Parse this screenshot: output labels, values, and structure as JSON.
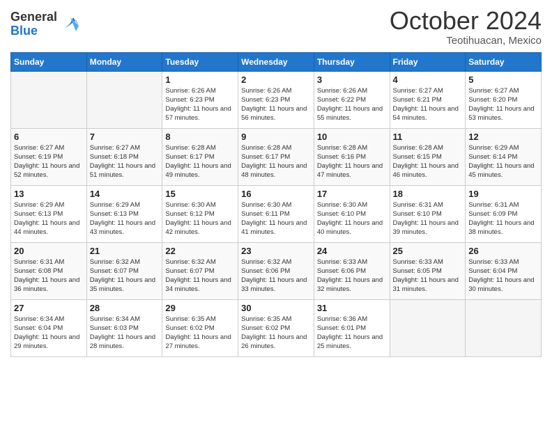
{
  "header": {
    "logo": {
      "general": "General",
      "blue": "Blue"
    },
    "month": "October 2024",
    "location": "Teotihuacan, Mexico"
  },
  "weekdays": [
    "Sunday",
    "Monday",
    "Tuesday",
    "Wednesday",
    "Thursday",
    "Friday",
    "Saturday"
  ],
  "weeks": [
    [
      {
        "day": "",
        "sunrise": "",
        "sunset": "",
        "daylight": "",
        "empty": true
      },
      {
        "day": "",
        "sunrise": "",
        "sunset": "",
        "daylight": "",
        "empty": true
      },
      {
        "day": "1",
        "sunrise": "Sunrise: 6:26 AM",
        "sunset": "Sunset: 6:23 PM",
        "daylight": "Daylight: 11 hours and 57 minutes.",
        "empty": false
      },
      {
        "day": "2",
        "sunrise": "Sunrise: 6:26 AM",
        "sunset": "Sunset: 6:23 PM",
        "daylight": "Daylight: 11 hours and 56 minutes.",
        "empty": false
      },
      {
        "day": "3",
        "sunrise": "Sunrise: 6:26 AM",
        "sunset": "Sunset: 6:22 PM",
        "daylight": "Daylight: 11 hours and 55 minutes.",
        "empty": false
      },
      {
        "day": "4",
        "sunrise": "Sunrise: 6:27 AM",
        "sunset": "Sunset: 6:21 PM",
        "daylight": "Daylight: 11 hours and 54 minutes.",
        "empty": false
      },
      {
        "day": "5",
        "sunrise": "Sunrise: 6:27 AM",
        "sunset": "Sunset: 6:20 PM",
        "daylight": "Daylight: 11 hours and 53 minutes.",
        "empty": false
      }
    ],
    [
      {
        "day": "6",
        "sunrise": "Sunrise: 6:27 AM",
        "sunset": "Sunset: 6:19 PM",
        "daylight": "Daylight: 11 hours and 52 minutes.",
        "empty": false
      },
      {
        "day": "7",
        "sunrise": "Sunrise: 6:27 AM",
        "sunset": "Sunset: 6:18 PM",
        "daylight": "Daylight: 11 hours and 51 minutes.",
        "empty": false
      },
      {
        "day": "8",
        "sunrise": "Sunrise: 6:28 AM",
        "sunset": "Sunset: 6:17 PM",
        "daylight": "Daylight: 11 hours and 49 minutes.",
        "empty": false
      },
      {
        "day": "9",
        "sunrise": "Sunrise: 6:28 AM",
        "sunset": "Sunset: 6:17 PM",
        "daylight": "Daylight: 11 hours and 48 minutes.",
        "empty": false
      },
      {
        "day": "10",
        "sunrise": "Sunrise: 6:28 AM",
        "sunset": "Sunset: 6:16 PM",
        "daylight": "Daylight: 11 hours and 47 minutes.",
        "empty": false
      },
      {
        "day": "11",
        "sunrise": "Sunrise: 6:28 AM",
        "sunset": "Sunset: 6:15 PM",
        "daylight": "Daylight: 11 hours and 46 minutes.",
        "empty": false
      },
      {
        "day": "12",
        "sunrise": "Sunrise: 6:29 AM",
        "sunset": "Sunset: 6:14 PM",
        "daylight": "Daylight: 11 hours and 45 minutes.",
        "empty": false
      }
    ],
    [
      {
        "day": "13",
        "sunrise": "Sunrise: 6:29 AM",
        "sunset": "Sunset: 6:13 PM",
        "daylight": "Daylight: 11 hours and 44 minutes.",
        "empty": false
      },
      {
        "day": "14",
        "sunrise": "Sunrise: 6:29 AM",
        "sunset": "Sunset: 6:13 PM",
        "daylight": "Daylight: 11 hours and 43 minutes.",
        "empty": false
      },
      {
        "day": "15",
        "sunrise": "Sunrise: 6:30 AM",
        "sunset": "Sunset: 6:12 PM",
        "daylight": "Daylight: 11 hours and 42 minutes.",
        "empty": false
      },
      {
        "day": "16",
        "sunrise": "Sunrise: 6:30 AM",
        "sunset": "Sunset: 6:11 PM",
        "daylight": "Daylight: 11 hours and 41 minutes.",
        "empty": false
      },
      {
        "day": "17",
        "sunrise": "Sunrise: 6:30 AM",
        "sunset": "Sunset: 6:10 PM",
        "daylight": "Daylight: 11 hours and 40 minutes.",
        "empty": false
      },
      {
        "day": "18",
        "sunrise": "Sunrise: 6:31 AM",
        "sunset": "Sunset: 6:10 PM",
        "daylight": "Daylight: 11 hours and 39 minutes.",
        "empty": false
      },
      {
        "day": "19",
        "sunrise": "Sunrise: 6:31 AM",
        "sunset": "Sunset: 6:09 PM",
        "daylight": "Daylight: 11 hours and 38 minutes.",
        "empty": false
      }
    ],
    [
      {
        "day": "20",
        "sunrise": "Sunrise: 6:31 AM",
        "sunset": "Sunset: 6:08 PM",
        "daylight": "Daylight: 11 hours and 36 minutes.",
        "empty": false
      },
      {
        "day": "21",
        "sunrise": "Sunrise: 6:32 AM",
        "sunset": "Sunset: 6:07 PM",
        "daylight": "Daylight: 11 hours and 35 minutes.",
        "empty": false
      },
      {
        "day": "22",
        "sunrise": "Sunrise: 6:32 AM",
        "sunset": "Sunset: 6:07 PM",
        "daylight": "Daylight: 11 hours and 34 minutes.",
        "empty": false
      },
      {
        "day": "23",
        "sunrise": "Sunrise: 6:32 AM",
        "sunset": "Sunset: 6:06 PM",
        "daylight": "Daylight: 11 hours and 33 minutes.",
        "empty": false
      },
      {
        "day": "24",
        "sunrise": "Sunrise: 6:33 AM",
        "sunset": "Sunset: 6:06 PM",
        "daylight": "Daylight: 11 hours and 32 minutes.",
        "empty": false
      },
      {
        "day": "25",
        "sunrise": "Sunrise: 6:33 AM",
        "sunset": "Sunset: 6:05 PM",
        "daylight": "Daylight: 11 hours and 31 minutes.",
        "empty": false
      },
      {
        "day": "26",
        "sunrise": "Sunrise: 6:33 AM",
        "sunset": "Sunset: 6:04 PM",
        "daylight": "Daylight: 11 hours and 30 minutes.",
        "empty": false
      }
    ],
    [
      {
        "day": "27",
        "sunrise": "Sunrise: 6:34 AM",
        "sunset": "Sunset: 6:04 PM",
        "daylight": "Daylight: 11 hours and 29 minutes.",
        "empty": false
      },
      {
        "day": "28",
        "sunrise": "Sunrise: 6:34 AM",
        "sunset": "Sunset: 6:03 PM",
        "daylight": "Daylight: 11 hours and 28 minutes.",
        "empty": false
      },
      {
        "day": "29",
        "sunrise": "Sunrise: 6:35 AM",
        "sunset": "Sunset: 6:02 PM",
        "daylight": "Daylight: 11 hours and 27 minutes.",
        "empty": false
      },
      {
        "day": "30",
        "sunrise": "Sunrise: 6:35 AM",
        "sunset": "Sunset: 6:02 PM",
        "daylight": "Daylight: 11 hours and 26 minutes.",
        "empty": false
      },
      {
        "day": "31",
        "sunrise": "Sunrise: 6:36 AM",
        "sunset": "Sunset: 6:01 PM",
        "daylight": "Daylight: 11 hours and 25 minutes.",
        "empty": false
      },
      {
        "day": "",
        "sunrise": "",
        "sunset": "",
        "daylight": "",
        "empty": true
      },
      {
        "day": "",
        "sunrise": "",
        "sunset": "",
        "daylight": "",
        "empty": true
      }
    ]
  ]
}
